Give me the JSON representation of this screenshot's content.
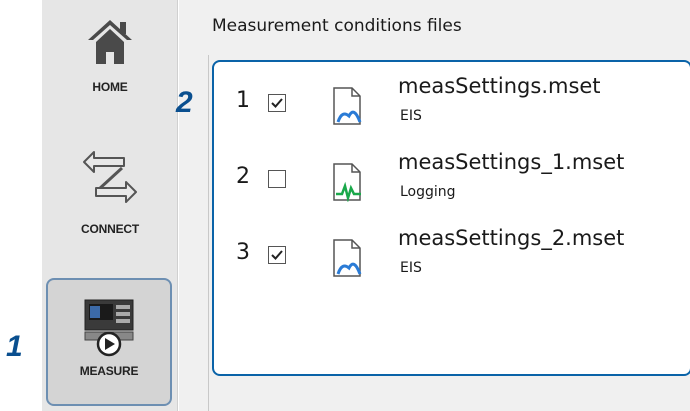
{
  "sidebar": {
    "home_label": "HOME",
    "connect_label": "CONNECT",
    "measure_label": "MEASURE"
  },
  "main": {
    "section_title": "Measurement conditions files",
    "files": [
      {
        "number": "1",
        "checked": true,
        "name": "measSettings.mset",
        "type": "EIS",
        "icon": "eis-file-icon"
      },
      {
        "number": "2",
        "checked": false,
        "name": "measSettings_1.mset",
        "type": "Logging",
        "icon": "logging-file-icon"
      },
      {
        "number": "3",
        "checked": true,
        "name": "measSettings_2.mset",
        "type": "EIS",
        "icon": "eis-file-icon"
      }
    ]
  },
  "callouts": {
    "first": "1",
    "second": "2"
  },
  "colors": {
    "accent": "#0a63a8",
    "eis_icon": "#2a7bd6",
    "logging_icon": "#1aa84a",
    "sidebar_bg": "#e6e6e6"
  }
}
